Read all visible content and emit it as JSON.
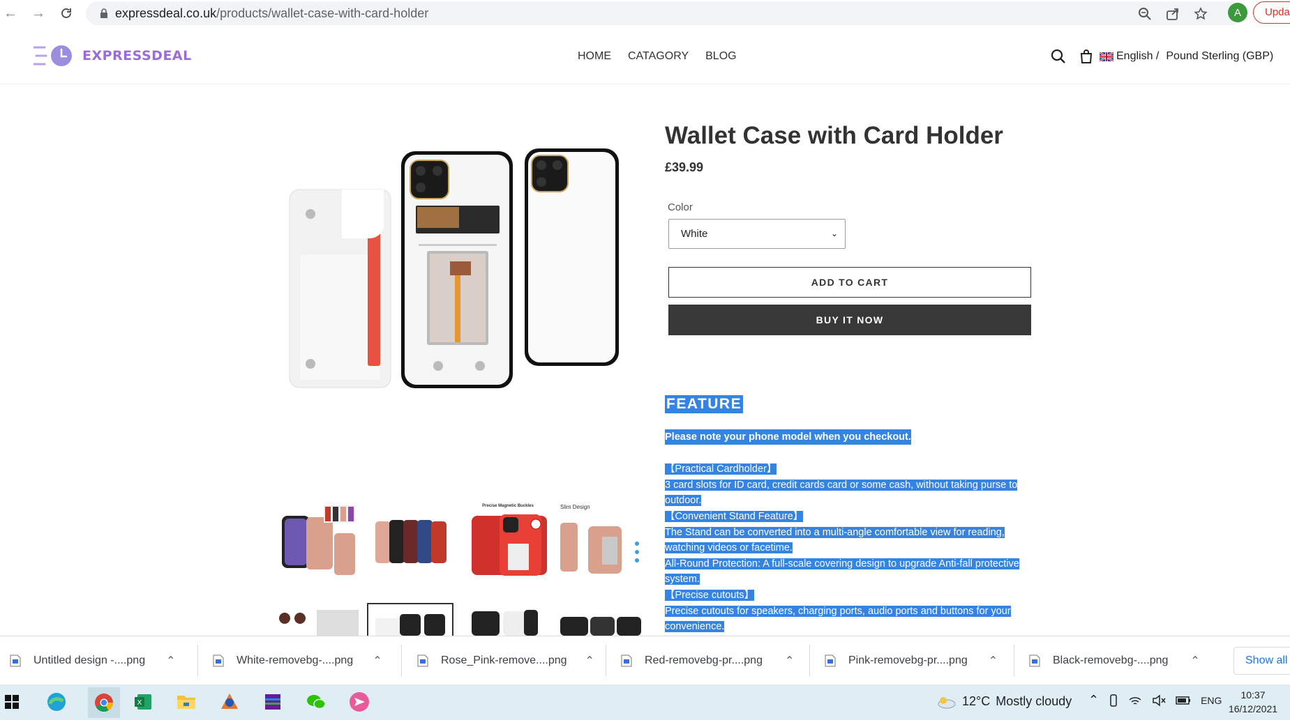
{
  "browser": {
    "url_host": "expressdeal.co.uk",
    "url_path": "/products/wallet-case-with-card-holder",
    "avatar_letter": "A",
    "update_label": "Upda"
  },
  "header": {
    "logo_text": "EXPRESSDEAL",
    "nav": [
      "HOME",
      "CATAGORY",
      "BLOG"
    ],
    "language": "English /",
    "currency": "Pound Sterling (GBP)"
  },
  "product": {
    "title": "Wallet Case with Card Holder",
    "price": "£39.99",
    "color_label": "Color",
    "color_value": "White",
    "add_to_cart": "ADD TO CART",
    "buy_now": "BUY IT NOW"
  },
  "description": {
    "heading": "FEATURE",
    "note": "Please note your phone model when you checkout.",
    "lines": [
      "【Practical Cardholder】",
      "3 card slots for ID card, credit cards card or some cash, without taking purse to outdoor.",
      "【Convenient Stand Feature】",
      "The Stand can be converted into a multi-angle comfortable view for reading, watching videos or facetime.",
      "All-Round Protection: A full-scale covering design to upgrade Anti-fall protective system.",
      "【Precise cutouts】",
      "Precise cutouts for speakers, charging ports, audio ports and buttons for your convenience."
    ]
  },
  "thumbs": {
    "t3_caption": "Precise Magnetic Buckles",
    "t4_caption": "Slim Design"
  },
  "downloads": {
    "items": [
      "Untitled design -....png",
      "White-removebg-....png",
      "Rose_Pink-remove....png",
      "Red-removebg-pr....png",
      "Pink-removebg-pr....png",
      "Black-removebg-....png"
    ],
    "show_all": "Show all"
  },
  "taskbar": {
    "temperature": "12°C",
    "weather": "Mostly cloudy",
    "lang": "ENG",
    "time": "10:37",
    "date": "16/12/2021"
  },
  "colors": {
    "selection": "#3584e4",
    "logo": "#9b6cd8",
    "buy_button": "#383838"
  }
}
